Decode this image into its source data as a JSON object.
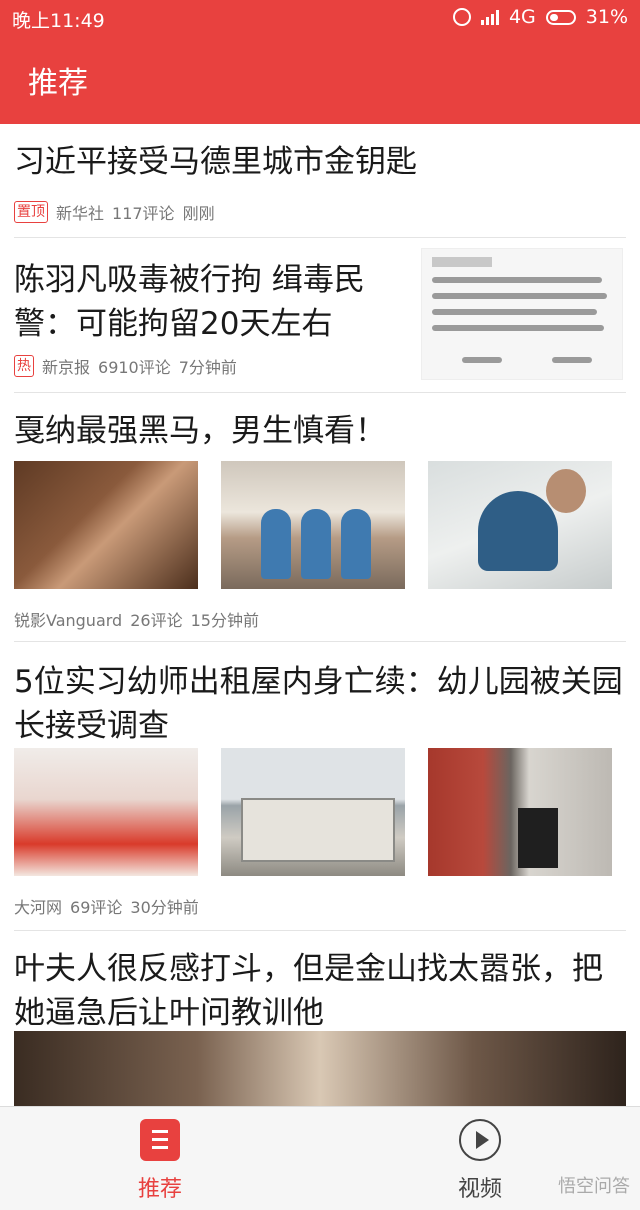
{
  "status_bar": {
    "time": "晚上11:49",
    "network": "4G",
    "battery": "31%"
  },
  "header": {
    "title": "推荐"
  },
  "feed": [
    {
      "headline": "习近平接受马德里城市金钥匙",
      "tag": "置顶",
      "source": "新华社",
      "comments": "117评论",
      "time": "刚刚"
    },
    {
      "headline": "陈羽凡吸毒被行拘 缉毒民警：可能拘留20天左右",
      "tag": "热",
      "source": "新京报",
      "comments": "6910评论",
      "time": "7分钟前"
    },
    {
      "headline": "戛纳最强黑马，男生慎看！",
      "source": "锐影Vanguard",
      "comments": "26评论",
      "time": "15分钟前"
    },
    {
      "headline": "5位实习幼师出租屋内身亡续：幼儿园被关园长接受调查",
      "source": "大河网",
      "comments": "69评论",
      "time": "30分钟前"
    },
    {
      "headline": "叶夫人很反感打斗，但是金山找太嚣张，把她逼急后让叶问教训他"
    }
  ],
  "bottom_nav": {
    "recommend": "推荐",
    "video": "视频",
    "watermark": "悟空问答"
  },
  "colors": {
    "accent": "#e8413f"
  }
}
